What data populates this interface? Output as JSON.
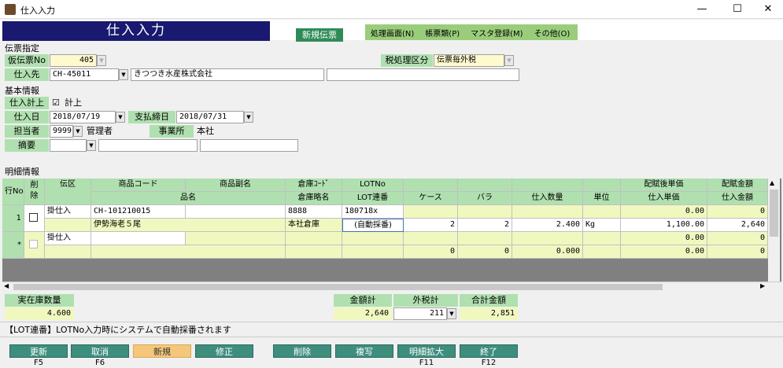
{
  "window": {
    "title": "仕入入力",
    "minimize": "—",
    "maximize": "☐",
    "close": "✕"
  },
  "header": {
    "form_title": "仕入入力",
    "mode": "新規伝票"
  },
  "menu": [
    "処理画面(N)",
    "帳票類(P)",
    "マスタ登録(M)",
    "その他(O)"
  ],
  "slip": {
    "section": "伝票指定",
    "temp_no_label": "仮伝票No",
    "temp_no": "405",
    "tax_label": "税処理区分",
    "tax_value": "伝票毎外税",
    "supplier_label": "仕入先",
    "supplier_code": "CH-45011",
    "supplier_name": "きつつき水産株式会社",
    "supplier_extra": ""
  },
  "basic": {
    "section": "基本情報",
    "post_label": "仕入計上",
    "post_check": "☑",
    "post_text": "計上",
    "date_label": "仕入日",
    "date": "2018/07/19",
    "close_label": "支払締日",
    "close_date": "2018/07/31",
    "staff_label": "担当者",
    "staff_code": "9999",
    "staff_name": "管理者",
    "office_label": "事業所",
    "office": "本社",
    "memo_label": "摘要"
  },
  "detail": {
    "section": "明細情報",
    "headers_top": [
      "行No",
      "削除",
      "伝区",
      "商品コード",
      "商品副名",
      "倉庫ｺｰﾄﾞ",
      "LOTNo",
      "",
      "",
      "",
      "",
      "配賦後単価",
      "配賦金額"
    ],
    "headers_bottom": [
      "品名",
      "倉庫略名",
      "LOT連番",
      "ケース",
      "バラ",
      "仕入数量",
      "単位",
      "仕入単価",
      "仕入金額"
    ],
    "row1": {
      "no": "1",
      "kubun": "掛仕入",
      "code": "CH-101210015",
      "subname": "",
      "wh_code": "8888",
      "lot": "180718x",
      "alloc_price": "0.00",
      "alloc_amount": "0",
      "name": "伊勢海老５尾",
      "wh_name": "本社倉庫",
      "lot_seq": "(自動採番)",
      "case": "2",
      "bara": "2",
      "qty": "2.400",
      "unit": "Kg",
      "price": "1,100.00",
      "amount": "2,640"
    },
    "row_new": {
      "no": "*",
      "kubun": "掛仕入",
      "alloc_price": "0.00",
      "alloc_amount": "0",
      "case": "0",
      "bara": "0",
      "qty": "0.000",
      "price": "0.00",
      "amount": "0"
    }
  },
  "totals": {
    "stock_label": "実在庫数量",
    "stock": "4.600",
    "amount_label": "金額計",
    "amount": "2,640",
    "tax_label": "外税計",
    "tax": "211",
    "total_label": "合計金額",
    "total": "2,851"
  },
  "message": "【LOT連番】LOTNo入力時にシステムで自動採番されます",
  "fkeys": [
    {
      "label": "更新",
      "key": "F5"
    },
    {
      "label": "取消",
      "key": "F6"
    },
    {
      "label": "新規",
      "key": ""
    },
    {
      "label": "修正",
      "key": ""
    },
    {
      "label": "削除",
      "key": ""
    },
    {
      "label": "複写",
      "key": ""
    },
    {
      "label": "明細拡大",
      "key": "F11"
    },
    {
      "label": "終了",
      "key": "F12"
    }
  ]
}
